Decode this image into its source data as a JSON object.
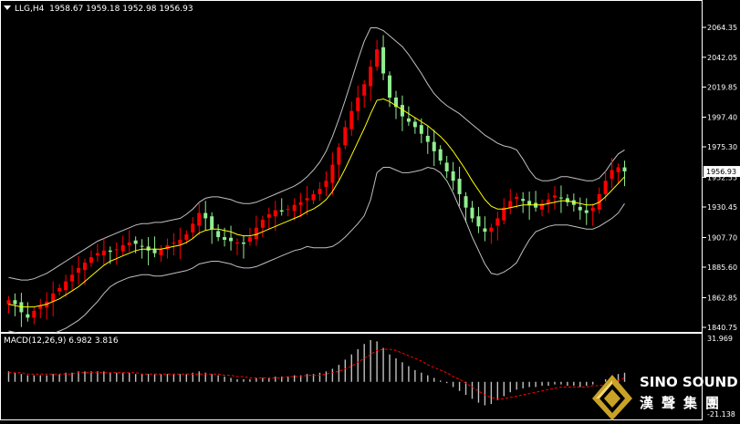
{
  "chart_header": {
    "symbol": "LLG,H4",
    "ohlc": "1958.67 1959.18 1952.98 1956.93"
  },
  "macd_header": {
    "label": "MACD(12,26,9) 6.982 3.816"
  },
  "price_axis": {
    "ticks": [
      "2064.35",
      "2042.05",
      "2019.85",
      "1997.40",
      "1975.30",
      "1952.55",
      "1930.45",
      "1907.70",
      "1885.60",
      "1862.85",
      "1840.75"
    ],
    "current_price": "1956.93"
  },
  "macd_axis": {
    "top": "31.969",
    "bottom": "-21.138"
  },
  "logo": {
    "name_en": "SINO SOUND",
    "name_cn": "漢聲集團"
  },
  "colors": {
    "bull_candle": "#ff0000",
    "bear_candle": "#90ee90",
    "ma_line": "#ffff00",
    "bands": "#c0c0c0",
    "macd_hist": "#c0c0c0",
    "macd_signal": "#ff0000",
    "logo_gold": "#c9a227"
  },
  "chart_data": [
    {
      "type": "candlestick",
      "title": "LLG,H4",
      "ylim": [
        1840.75,
        2064.35
      ],
      "close": [
        1861,
        1858,
        1852,
        1848,
        1853,
        1857,
        1860,
        1866,
        1870,
        1875,
        1880,
        1885,
        1889,
        1893,
        1896,
        1898,
        1897,
        1899,
        1902,
        1904,
        1903,
        1901,
        1898,
        1896,
        1899,
        1902,
        1904,
        1906,
        1910,
        1918,
        1926,
        1922,
        1914,
        1908,
        1906,
        1905,
        1904,
        1903,
        1908,
        1915,
        1921,
        1925,
        1928,
        1927,
        1929,
        1932,
        1934,
        1937,
        1940,
        1944,
        1950,
        1962,
        1975,
        1990,
        2002,
        2012,
        2022,
        2035,
        2048,
        2030,
        2012,
        2005,
        1998,
        1994,
        1990,
        1985,
        1979,
        1972,
        1965,
        1957,
        1950,
        1940,
        1930,
        1922,
        1916,
        1912,
        1915,
        1922,
        1930,
        1935,
        1938,
        1935,
        1932,
        1930,
        1933,
        1936,
        1939,
        1937,
        1934,
        1932,
        1928,
        1926,
        1930,
        1940,
        1950,
        1958,
        1960,
        1957
      ],
      "ma": [
        1858,
        1857,
        1856,
        1856,
        1856,
        1857,
        1858,
        1860,
        1862,
        1865,
        1868,
        1871,
        1875,
        1879,
        1883,
        1887,
        1890,
        1892,
        1894,
        1896,
        1898,
        1899,
        1899,
        1899,
        1899,
        1900,
        1901,
        1902,
        1904,
        1907,
        1911,
        1913,
        1914,
        1914,
        1913,
        1912,
        1910,
        1909,
        1909,
        1910,
        1912,
        1914,
        1916,
        1918,
        1920,
        1922,
        1924,
        1927,
        1929,
        1932,
        1936,
        1942,
        1950,
        1959,
        1969,
        1979,
        1989,
        2000,
        2010,
        2011,
        2009,
        2006,
        2003,
        2000,
        1997,
        1994,
        1991,
        1987,
        1983,
        1978,
        1972,
        1965,
        1958,
        1950,
        1943,
        1936,
        1931,
        1929,
        1929,
        1930,
        1931,
        1932,
        1932,
        1932,
        1932,
        1933,
        1934,
        1935,
        1935,
        1934,
        1933,
        1932,
        1932,
        1934,
        1938,
        1943,
        1948,
        1953
      ],
      "upper_band": [
        1878,
        1877,
        1876,
        1876,
        1877,
        1879,
        1881,
        1884,
        1887,
        1890,
        1893,
        1896,
        1899,
        1902,
        1905,
        1907,
        1909,
        1911,
        1913,
        1915,
        1917,
        1918,
        1918,
        1919,
        1919,
        1920,
        1921,
        1922,
        1925,
        1929,
        1934,
        1937,
        1938,
        1938,
        1937,
        1936,
        1934,
        1933,
        1933,
        1934,
        1936,
        1938,
        1940,
        1942,
        1944,
        1946,
        1949,
        1953,
        1958,
        1964,
        1972,
        1983,
        1996,
        2010,
        2025,
        2040,
        2054,
        2064,
        2064,
        2062,
        2058,
        2054,
        2050,
        2044,
        2037,
        2030,
        2022,
        2015,
        2010,
        2006,
        2003,
        2000,
        1996,
        1992,
        1988,
        1984,
        1981,
        1978,
        1976,
        1975,
        1973,
        1966,
        1958,
        1952,
        1950,
        1950,
        1951,
        1953,
        1953,
        1952,
        1951,
        1950,
        1950,
        1952,
        1957,
        1964,
        1970,
        1973
      ],
      "lower_band": [
        1838,
        1837,
        1836,
        1836,
        1835,
        1835,
        1835,
        1836,
        1838,
        1840,
        1843,
        1846,
        1850,
        1855,
        1860,
        1866,
        1871,
        1874,
        1876,
        1878,
        1879,
        1880,
        1880,
        1879,
        1879,
        1880,
        1881,
        1882,
        1883,
        1885,
        1888,
        1889,
        1890,
        1890,
        1889,
        1888,
        1886,
        1885,
        1885,
        1886,
        1888,
        1890,
        1892,
        1894,
        1896,
        1898,
        1899,
        1901,
        1900,
        1900,
        1900,
        1901,
        1904,
        1908,
        1913,
        1918,
        1924,
        1936,
        1956,
        1960,
        1960,
        1958,
        1956,
        1956,
        1957,
        1958,
        1960,
        1959,
        1956,
        1950,
        1941,
        1930,
        1920,
        1908,
        1898,
        1888,
        1881,
        1880,
        1882,
        1885,
        1889,
        1898,
        1906,
        1912,
        1914,
        1916,
        1917,
        1917,
        1917,
        1916,
        1915,
        1914,
        1914,
        1916,
        1919,
        1922,
        1926,
        1933
      ]
    },
    {
      "type": "bar",
      "title": "MACD(12,26,9)",
      "ylim": [
        -21.138,
        31.969
      ],
      "histogram": [
        8,
        7,
        6,
        5,
        5,
        5,
        5,
        6,
        6,
        7,
        7,
        8,
        8,
        8,
        8,
        8,
        7,
        7,
        7,
        7,
        6,
        6,
        6,
        6,
        6,
        6,
        6,
        6,
        6,
        7,
        8,
        7,
        6,
        5,
        4,
        3,
        2,
        2,
        2,
        3,
        3,
        3,
        4,
        4,
        4,
        5,
        5,
        6,
        6,
        7,
        8,
        10,
        13,
        17,
        21,
        25,
        29,
        32,
        31,
        26,
        21,
        18,
        15,
        12,
        9,
        7,
        5,
        3,
        1,
        -1,
        -4,
        -7,
        -10,
        -13,
        -16,
        -18,
        -17,
        -14,
        -11,
        -8,
        -6,
        -5,
        -4,
        -4,
        -3,
        -3,
        -2,
        -2,
        -3,
        -3,
        -4,
        -3,
        -2,
        0,
        2,
        4,
        6,
        7
      ],
      "signal": [
        7,
        7,
        7,
        6,
        6,
        6,
        6,
        6,
        6,
        6,
        6,
        7,
        7,
        7,
        7,
        7,
        7,
        7,
        7,
        7,
        7,
        6,
        6,
        6,
        6,
        6,
        6,
        6,
        6,
        6,
        6,
        6,
        6,
        6,
        5,
        5,
        4,
        4,
        3,
        3,
        3,
        3,
        3,
        3,
        4,
        4,
        4,
        5,
        5,
        5,
        6,
        7,
        8,
        10,
        12,
        15,
        18,
        21,
        24,
        25,
        25,
        24,
        22,
        20,
        18,
        16,
        13,
        11,
        9,
        7,
        4,
        2,
        -1,
        -4,
        -7,
        -10,
        -12,
        -13,
        -13,
        -12,
        -11,
        -10,
        -9,
        -8,
        -7,
        -6,
        -5,
        -4,
        -4,
        -4,
        -4,
        -4,
        -3,
        -3,
        -2,
        -1,
        1,
        3
      ]
    }
  ]
}
